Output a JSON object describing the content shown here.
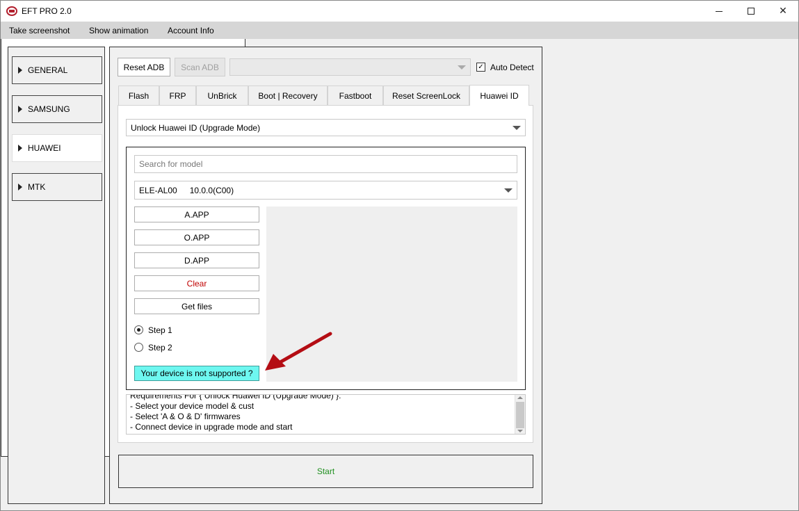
{
  "window": {
    "title": "EFT PRO 2.0"
  },
  "menu": {
    "items": [
      "Take screenshot",
      "Show animation",
      "Account Info"
    ]
  },
  "sidebar": {
    "items": [
      {
        "label": "GENERAL",
        "active": false
      },
      {
        "label": "SAMSUNG",
        "active": false
      },
      {
        "label": "HUAWEI",
        "active": true
      },
      {
        "label": "MTK",
        "active": false
      }
    ]
  },
  "toolbar": {
    "reset_adb": "Reset ADB",
    "scan_adb": "Scan ADB",
    "port_value": "",
    "auto_detect_label": "Auto Detect",
    "auto_detect_checked": true
  },
  "tabs": [
    "Flash",
    "FRP",
    "UnBrick",
    "Boot | Recovery",
    "Fastboot",
    "Reset ScreenLock",
    "Huawei ID"
  ],
  "active_tab": "Huawei ID",
  "huawei": {
    "operation": "Unlock Huawei ID (Upgrade Mode)",
    "search_placeholder": "Search for model",
    "model": "ELE-AL00",
    "version": "10.0.0(C00)",
    "buttons": {
      "a_app": "A.APP",
      "o_app": "O.APP",
      "d_app": "D.APP",
      "clear": "Clear",
      "get_files": "Get files"
    },
    "steps": [
      {
        "label": "Step 1",
        "checked": true
      },
      {
        "label": "Step 2",
        "checked": false
      }
    ],
    "unsupported_link": "Your device is not supported ?",
    "requirements": [
      "Requirements For { Unlock Huawei ID (Upgrade Mode) }:",
      " - Select your device model & cust",
      " - Select 'A & O & D' firmwares",
      " - Connect device in upgrade mode and start"
    ]
  },
  "start_label": "Start",
  "colors": {
    "start_text": "#1f8f1f",
    "clear_text": "#c00000",
    "badge_bg": "#6ef7f0",
    "arrow": "#b40d14"
  },
  "icons": {
    "app": "eft-logo-icon",
    "check": "checkmark-icon",
    "dropdown": "chevron-down-icon",
    "annotation": "red-arrow-icon"
  }
}
